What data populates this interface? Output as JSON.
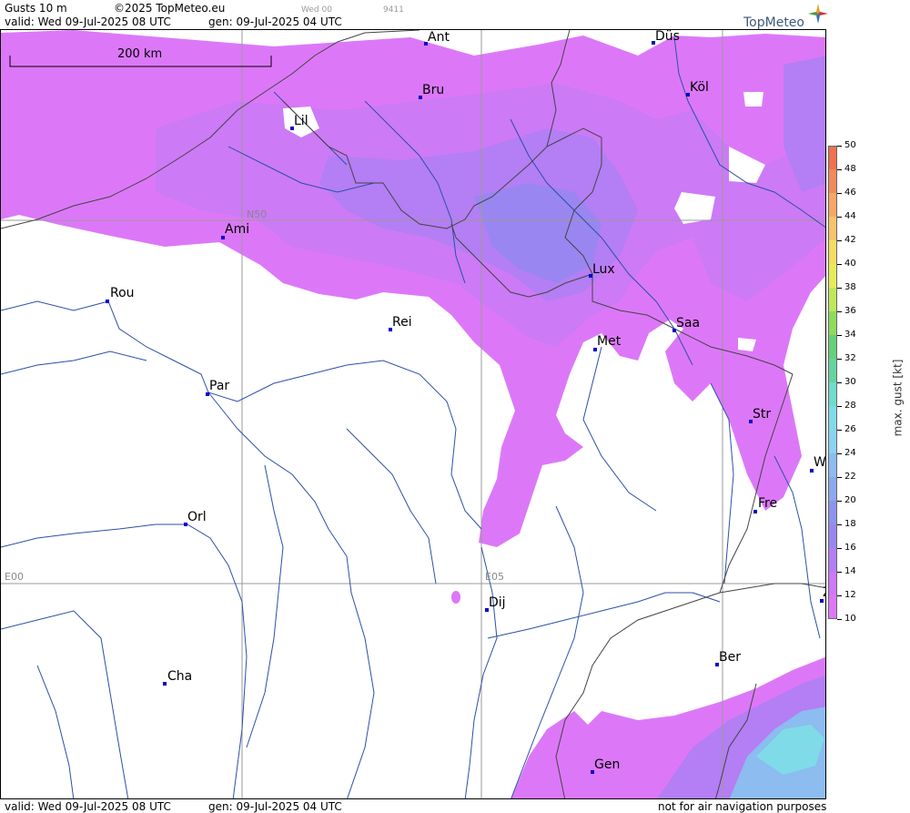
{
  "header": {
    "product": "Gusts 10 m",
    "copyright": "©2025 TopMeteo.eu",
    "run_small": "Wed 00",
    "code_small": "9411",
    "valid": "valid:  Wed  09-Jul-2025  08 UTC",
    "gen": "gen: 09-Jul-2025 04 UTC",
    "logo": "TopMeteo"
  },
  "footer": {
    "valid": "valid:  Wed  09-Jul-2025  08 UTC",
    "gen": "gen: 09-Jul-2025 04 UTC",
    "disclaimer": "not for air navigation purposes"
  },
  "map": {
    "scale_label": "200 km",
    "grid_labels": {
      "lat": "N50",
      "lon1": "E00",
      "lon2": "E05"
    },
    "cities": [
      {
        "label": "Ant"
      },
      {
        "label": "Düs"
      },
      {
        "label": "Bru"
      },
      {
        "label": "Köl"
      },
      {
        "label": "Lil"
      },
      {
        "label": "Ami"
      },
      {
        "label": "Lux"
      },
      {
        "label": "Rou"
      },
      {
        "label": "Rei"
      },
      {
        "label": "Saa"
      },
      {
        "label": "Met"
      },
      {
        "label": "Par"
      },
      {
        "label": "Str"
      },
      {
        "label": "W"
      },
      {
        "label": "Fre"
      },
      {
        "label": "Orl"
      },
      {
        "label": "Dij"
      },
      {
        "label": "Z"
      },
      {
        "label": "Ber"
      },
      {
        "label": "Cha"
      },
      {
        "label": "Gen"
      }
    ]
  },
  "legend": {
    "unit": "max. gust  [kt]",
    "ticks": [
      "50",
      "48",
      "46",
      "44",
      "42",
      "40",
      "38",
      "36",
      "34",
      "32",
      "30",
      "28",
      "26",
      "24",
      "22",
      "20",
      "18",
      "16",
      "14",
      "12",
      "10"
    ],
    "colors": {
      "50": "#f07050",
      "48": "#f48a5a",
      "46": "#f7a865",
      "44": "#f8c46a",
      "42": "#f5dd60",
      "40": "#e6ec58",
      "38": "#bfe85a",
      "36": "#8edc5c",
      "34": "#66d07a",
      "32": "#66d4a0",
      "30": "#70dccc",
      "28": "#80dbe8",
      "26": "#8cd2f2",
      "24": "#8cbcf0",
      "22": "#8ca8ee",
      "20": "#8c94ee",
      "18": "#9a86f0",
      "16": "#b47ef4",
      "14": "#cc7af6",
      "12": "#dc78f8"
    }
  }
}
